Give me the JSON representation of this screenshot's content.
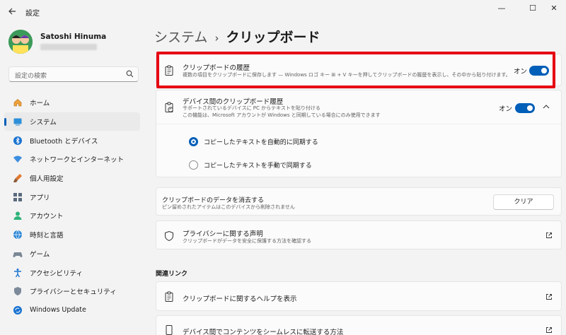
{
  "window": {
    "title": "設定",
    "controls": {
      "minimize": "—",
      "maximize": "☐",
      "close": "✕"
    }
  },
  "profile": {
    "name": "Satoshi Hinuma"
  },
  "search": {
    "placeholder": "設定の検索"
  },
  "nav": {
    "items": [
      {
        "label": "ホーム",
        "icon": "home-icon"
      },
      {
        "label": "システム",
        "icon": "system-icon",
        "selected": true
      },
      {
        "label": "Bluetooth とデバイス",
        "icon": "bluetooth-icon"
      },
      {
        "label": "ネットワークとインターネット",
        "icon": "network-icon"
      },
      {
        "label": "個人用設定",
        "icon": "personalization-icon"
      },
      {
        "label": "アプリ",
        "icon": "apps-icon"
      },
      {
        "label": "アカウント",
        "icon": "account-icon"
      },
      {
        "label": "時刻と言語",
        "icon": "time-language-icon"
      },
      {
        "label": "ゲーム",
        "icon": "gaming-icon"
      },
      {
        "label": "アクセシビリティ",
        "icon": "accessibility-icon"
      },
      {
        "label": "プライバシーとセキュリティ",
        "icon": "privacy-icon"
      },
      {
        "label": "Windows Update",
        "icon": "windows-update-icon"
      }
    ]
  },
  "breadcrumb": {
    "parent": "システム",
    "separator": "›",
    "current": "クリップボード"
  },
  "clipboard_history": {
    "title": "クリップボードの履歴",
    "description": "複数の項目をクリップボードに保存します — Windows ロゴ キー ⊞ + V キーを押してクリップボードの履歴を表示し、その中から貼り付けます。",
    "toggle_label": "オン",
    "enabled": true
  },
  "device_sync": {
    "title": "デバイス間のクリップボード履歴",
    "description1": "サポートされているデバイスに PC からテキストを貼り付ける",
    "description2": "この機能は、Microsoft アカウントが Windows と同期している場合にのみ使用できます",
    "toggle_label": "オン",
    "enabled": true,
    "chevron": "⌃",
    "options": [
      {
        "label": "コピーしたテキストを自動的に同期する",
        "selected": true
      },
      {
        "label": "コピーしたテキストを手動で同期する",
        "selected": false
      }
    ]
  },
  "clear_data": {
    "title": "クリップボードのデータを消去する",
    "description": "ピン留めされたアイテムはこのデバイスから削除されません",
    "button_label": "クリア"
  },
  "privacy": {
    "title": "プライバシーに関する声明",
    "description": "クリップボードがデータを安全に保護する方法を確認する"
  },
  "related_links": {
    "heading": "関連リンク",
    "items": [
      {
        "label": "クリップボードに関するヘルプを表示"
      },
      {
        "label": "デバイス間でコンテンツをシームレスに転送する方法"
      }
    ]
  },
  "colors": {
    "accent": "#005fb8",
    "highlight_border": "#e60012",
    "background": "#f3f3f3",
    "card": "#fbfbfb"
  }
}
